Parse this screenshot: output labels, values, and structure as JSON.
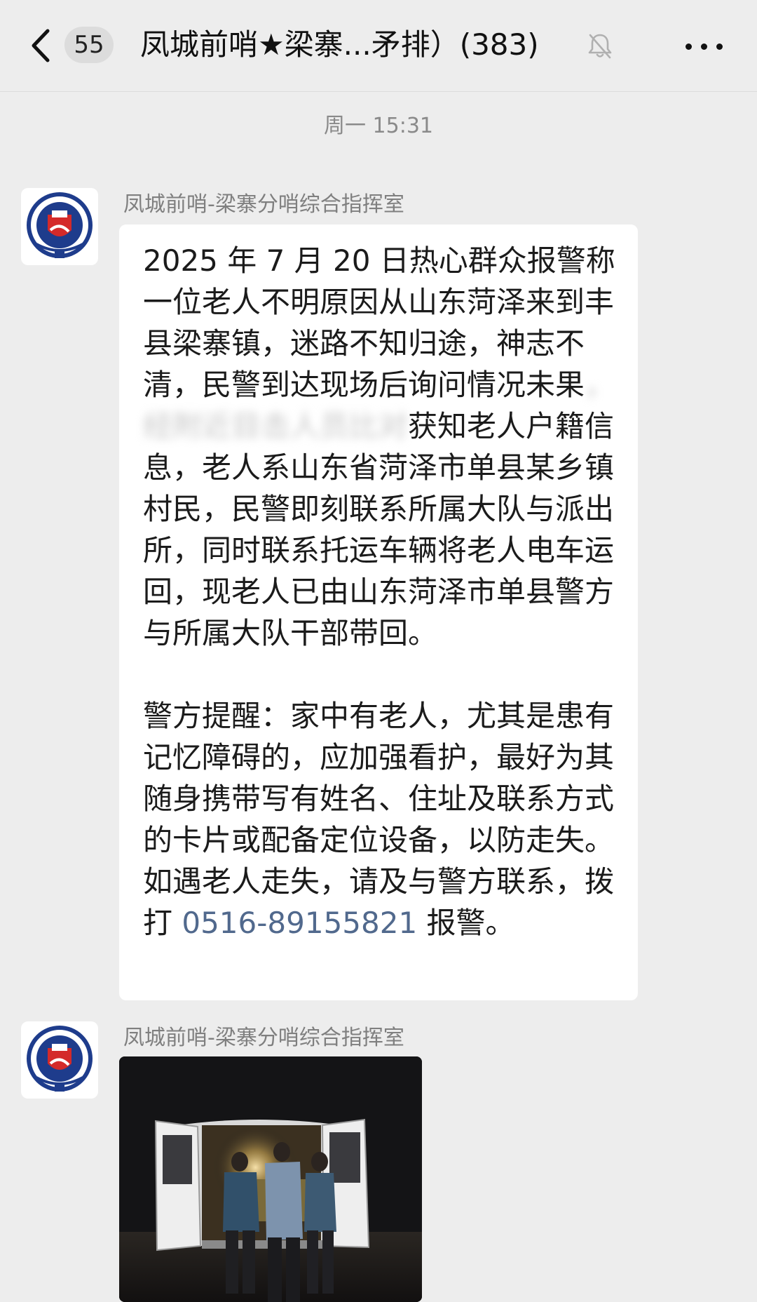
{
  "header": {
    "unread_count": "55",
    "title": "凤城前哨★梁寨...矛排）(383)",
    "icons": [
      "chevron-left-icon",
      "mute-bell-icon",
      "more-dots-icon"
    ]
  },
  "timestamp": "周一 15:31",
  "messages": [
    {
      "sender": "凤城前哨-梁寨分哨综合指挥室",
      "text_part1": "2025 年 7 月 20 日热心群众报警称一位老人不明原因从山东菏泽来到丰县梁寨镇，迷路不知归途，神志不清，民警到达现场后询问情况未果",
      "text_blurred": "，经附近目击人员比对",
      "text_part2": "获知老人户籍信息，老人系山东省菏泽市单县某乡镇村民，民警即刻联系所属大队与派出所，同时联系托运车辆将老人电车运回，现老人已由山东菏泽市单县警方与所属大队干部带回。\n\n警方提醒：家中有老人，尤其是患有记忆障碍的，应加强看护，最好为其随身携带写有姓名、住址及联系方式的卡片或配备定位设备，以防走失。如遇老人走失，请及与警方联系，拨打 ",
      "phone": "0516-89155821",
      "text_part3": " 报警。"
    },
    {
      "sender": "凤城前哨-梁寨分哨综合指挥室",
      "image_alt": "夜间民警在厢式货车旁协助老人"
    }
  ],
  "colors": {
    "background": "#ededed",
    "bubble": "#ffffff",
    "link": "#51698d",
    "emblem_blue": "#1e3c8c",
    "emblem_red": "#d42a2a"
  }
}
